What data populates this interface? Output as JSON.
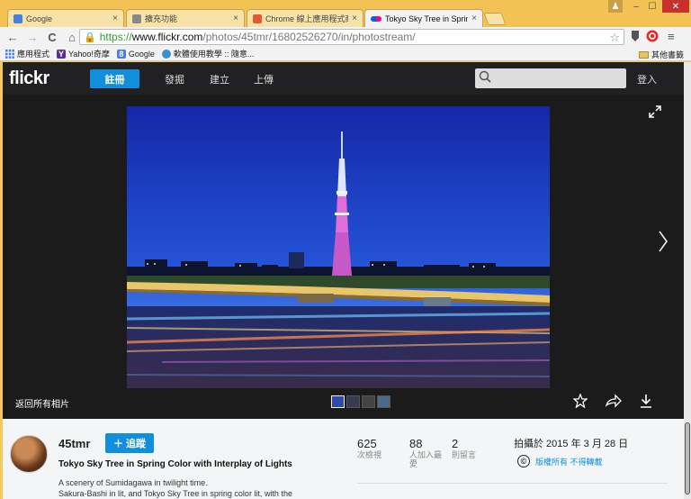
{
  "tabs": [
    {
      "title": "Google",
      "color": "#4a7fe0",
      "active": false
    },
    {
      "title": "擴充功能",
      "color": "#888888",
      "active": false
    },
    {
      "title": "Chrome 線上應用程式商",
      "color": "#e25a2f",
      "active": false
    },
    {
      "title": "Tokyo Sky Tree in Spring",
      "color": "#e8276e",
      "active": true
    }
  ],
  "tab_close": "×",
  "window": {
    "user": "♟",
    "min": "–",
    "max": "☐",
    "close": "✕"
  },
  "toolbar": {
    "back": "←",
    "forward": "→",
    "reload": "C",
    "home": "⌂",
    "star": "☆",
    "menu": "≡"
  },
  "url": {
    "scheme": "https://",
    "host": "www.flickr.com",
    "path": "/photos/45tmr/16802526270/in/photostream/"
  },
  "bookmarks": [
    {
      "label": "應用程式",
      "icon": "apps-icon",
      "color": "#4a7fe0"
    },
    {
      "label": "Yahoo!奇摩",
      "icon": "yahoo-icon",
      "color": "#5b2d8c"
    },
    {
      "label": "Google",
      "icon": "google-icon",
      "color": "#4a7fe0"
    },
    {
      "label": "軟體使用教學 :: 隨意...",
      "icon": "globe-icon",
      "color": "#3a8fd0"
    }
  ],
  "bookmarks_other": "其他書籤",
  "flickr": {
    "logo": "flickr",
    "signup": "註冊",
    "nav": [
      "發掘",
      "建立",
      "上傳"
    ],
    "login": "登入",
    "back_link": "返回所有相片",
    "user": "45tmr",
    "follow": "＋ 追蹤",
    "photo_title": "Tokyo Sky Tree in Spring Color with Interplay of Lights",
    "desc_1": "A scenery of Sumidagawa in twilight time.",
    "desc_2": "Sakura-Bashi in lit, and Tokyo Sky Tree in spring color lit, with the",
    "stats": [
      {
        "num": "625",
        "label": "次檢視"
      },
      {
        "num": "88",
        "label": "人加入最愛"
      },
      {
        "num": "2",
        "label": "則留言"
      }
    ],
    "taken": "拍攝於 2015 年 3 月 28 日",
    "license_icon": "©",
    "license": "版權所有 不得轉載"
  }
}
